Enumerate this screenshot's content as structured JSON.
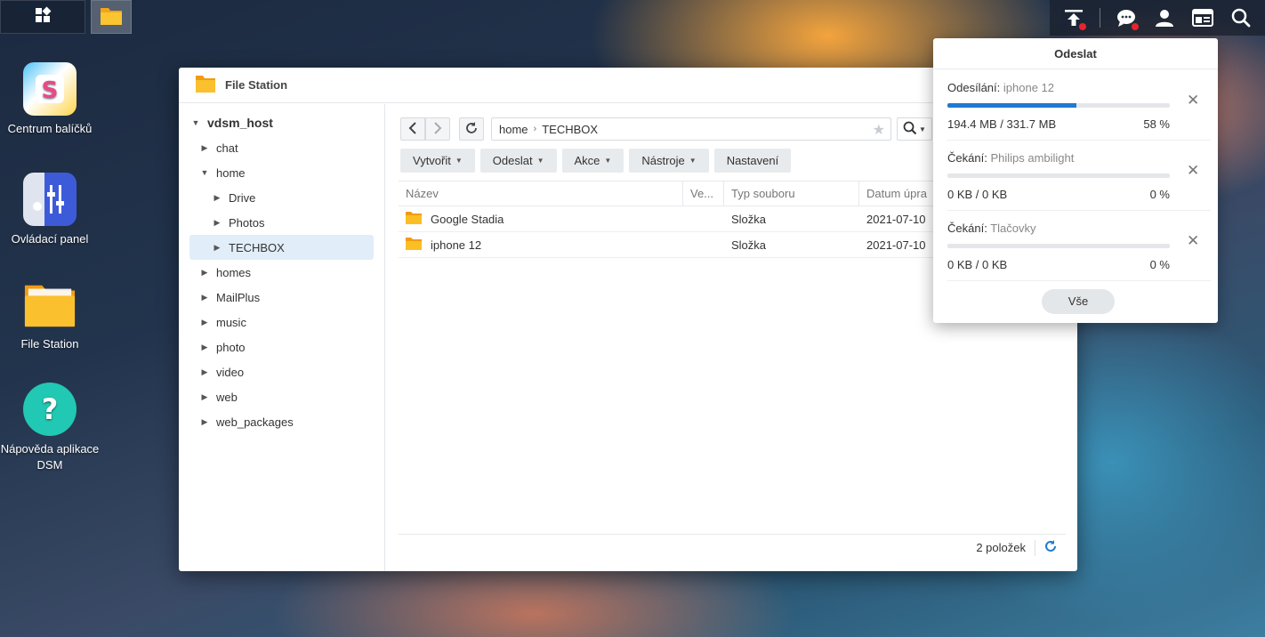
{
  "taskbar": {
    "left_icons": [
      "grid-icon",
      "file-station-icon"
    ],
    "right_icons": [
      "upload-icon",
      "chat-icon",
      "user-icon",
      "widget-icon",
      "search-icon"
    ]
  },
  "desktop": {
    "icons": [
      {
        "label": "Centrum balíčků",
        "icon": "package-center-icon"
      },
      {
        "label": "Ovládací panel",
        "icon": "control-panel-icon"
      },
      {
        "label": "File Station",
        "icon": "file-station-icon"
      },
      {
        "label": "Nápověda aplikace DSM",
        "icon": "help-icon"
      }
    ]
  },
  "window": {
    "title": "File Station",
    "tree": {
      "root": "vdsm_host",
      "items": [
        {
          "label": "chat"
        },
        {
          "label": "home"
        },
        {
          "label": "Drive"
        },
        {
          "label": "Photos"
        },
        {
          "label": "TECHBOX"
        },
        {
          "label": "homes"
        },
        {
          "label": "MailPlus"
        },
        {
          "label": "music"
        },
        {
          "label": "photo"
        },
        {
          "label": "video"
        },
        {
          "label": "web"
        },
        {
          "label": "web_packages"
        }
      ]
    },
    "path": [
      "home",
      "TECHBOX"
    ],
    "toolbar": {
      "create": "Vytvořit",
      "upload": "Odeslat",
      "action": "Akce",
      "tools": "Nástroje",
      "settings": "Nastavení"
    },
    "columns": [
      "Název",
      "Ve...",
      "Typ souboru",
      "Datum úpra"
    ],
    "rows": [
      {
        "name": "Google Stadia",
        "type": "Složka",
        "date": "2021-07-10"
      },
      {
        "name": "iphone 12",
        "type": "Složka",
        "date": "2021-07-10"
      }
    ],
    "status": {
      "count": "2 položek"
    }
  },
  "upload_panel": {
    "title": "Odeslat",
    "items": [
      {
        "state": "Odesílání:",
        "file": "iphone 12",
        "size": "194.4 MB / 331.7 MB",
        "percent": "58 %",
        "progress": 0.58
      },
      {
        "state": "Čekání:",
        "file": "Philips ambilight",
        "size": "0 KB / 0 KB",
        "percent": "0 %",
        "progress": 0
      },
      {
        "state": "Čekání:",
        "file": "Tlačovky",
        "size": "0 KB / 0 KB",
        "percent": "0 %",
        "progress": 0
      }
    ],
    "all_button": "Vše"
  },
  "colors": {
    "accent": "#1f7ad1",
    "folder": "#f7b21f",
    "selected_row": "#e1edf9"
  }
}
